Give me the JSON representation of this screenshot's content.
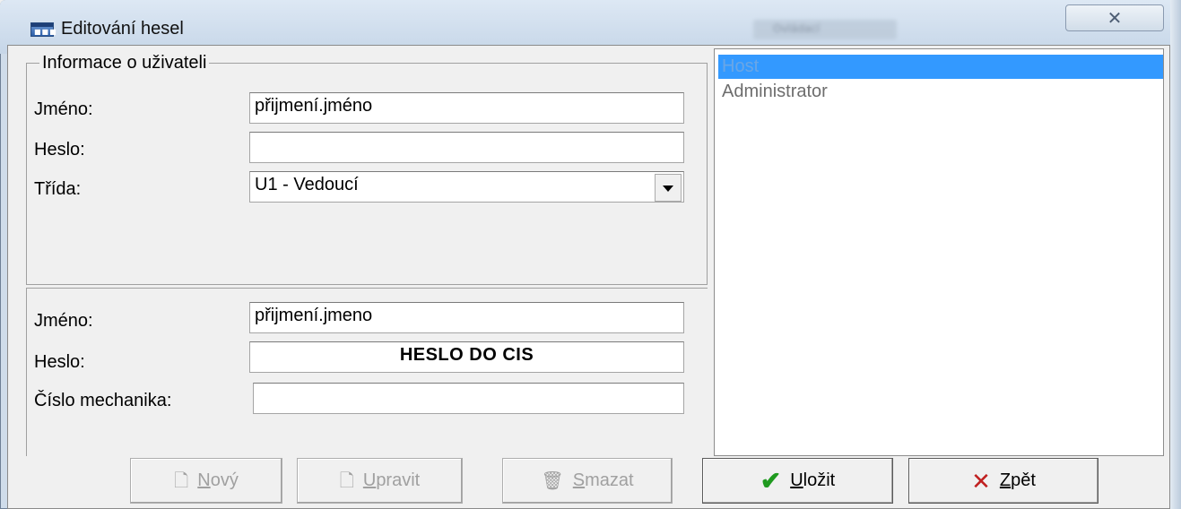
{
  "window": {
    "title": "Editování hesel",
    "close_label": "✕",
    "icon": "app-window-icon",
    "background_title_ghost": "Ovládací"
  },
  "user_info": {
    "group_title": "Informace o uživateli",
    "name_label": "Jméno:",
    "name_value": "přijmení.jméno",
    "password_label": "Heslo:",
    "password_value": "",
    "class_label": "Třída:",
    "class_value": "U1 - Vedoucí"
  },
  "cis_info": {
    "name_label": "Jméno:",
    "name_value": "přijmení.jmeno",
    "password_label": "Heslo:",
    "password_value": "HESLO DO CIS",
    "mechanic_label": "Číslo mechanika:",
    "mechanic_value": ""
  },
  "user_list": {
    "items": [
      {
        "label": "Host",
        "selected": true
      },
      {
        "label": "Administrator",
        "selected": false
      }
    ],
    "selection_color": "#3399ff"
  },
  "buttons": {
    "new": {
      "accel": "N",
      "rest": "ový",
      "enabled": false,
      "icon": "new-document-icon"
    },
    "edit": {
      "accel": "U",
      "rest": "pravit",
      "enabled": false,
      "icon": "edit-document-icon"
    },
    "delete": {
      "accel": "S",
      "rest": "mazat",
      "enabled": false,
      "icon": "trash-icon"
    },
    "save": {
      "accel": "U",
      "rest": "ložit",
      "enabled": true,
      "icon": "checkmark-icon"
    },
    "back": {
      "accel": "Z",
      "rest": "pět",
      "enabled": true,
      "icon": "x-icon"
    }
  },
  "colors": {
    "check": "#1f9a1f",
    "cross": "#c02020"
  }
}
